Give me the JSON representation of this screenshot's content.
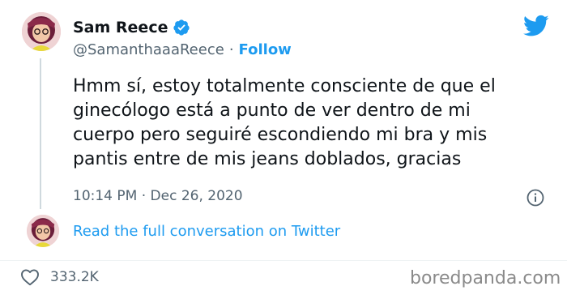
{
  "author": {
    "name": "Sam Reece",
    "handle": "@SamanthaaaReece",
    "separator": "·",
    "follow_label": "Follow",
    "verified": true
  },
  "tweet": {
    "lines": [
      "Hmm sí, estoy totalmente consciente de que el",
      "ginecólogo está a punto de ver dentro de mi",
      "cuerpo pero seguiré escondiendo mi bra y mis",
      "pantis entre de mis jeans doblados, gracias"
    ],
    "timestamp": "10:14 PM · Dec 26, 2020"
  },
  "conversation_link": "Read the full conversation on Twitter",
  "engagement": {
    "likes": "333.2K"
  },
  "watermark": "boredpanda.com",
  "icons": {
    "brand": "twitter-bird-icon",
    "verified": "verified-badge-icon",
    "info": "info-icon",
    "like": "heart-icon"
  },
  "colors": {
    "accent": "#1d9bf0",
    "text": "#0f1419",
    "secondary": "#536471"
  }
}
